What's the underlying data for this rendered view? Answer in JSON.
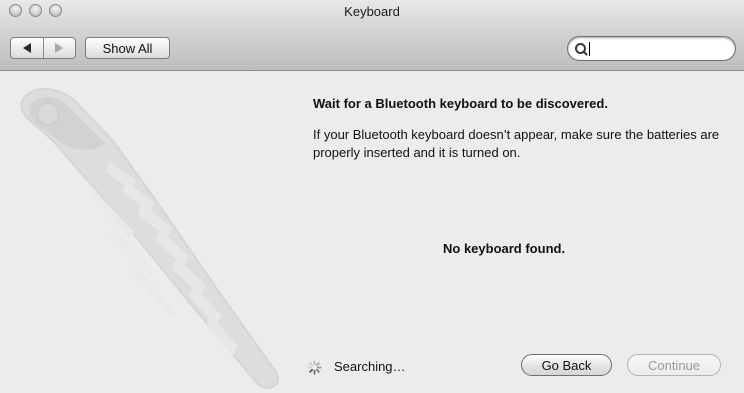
{
  "window": {
    "title": "Keyboard"
  },
  "toolbar": {
    "show_all_label": "Show All",
    "search": {
      "value": "",
      "placeholder": ""
    }
  },
  "content": {
    "heading": "Wait for a Bluetooth keyboard to be discovered.",
    "description": "If your Bluetooth keyboard doesn’t appear, make sure the batteries are properly inserted and it is turned on.",
    "status_message": "No keyboard found.",
    "searching_label": "Searching…"
  },
  "buttons": {
    "go_back": "Go Back",
    "continue": "Continue"
  },
  "icons": {
    "back": "back-arrow-icon",
    "forward": "forward-arrow-icon",
    "search": "magnifier-icon",
    "spinner": "spinner-icon",
    "illustration": "bluetooth-keyboard-icon"
  }
}
